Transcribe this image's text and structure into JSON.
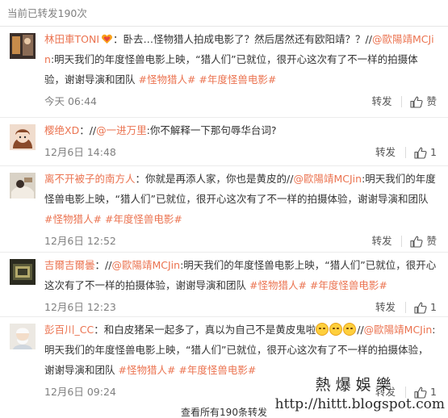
{
  "header": {
    "title": "当前已转发190次"
  },
  "reposts": [
    {
      "user": "林田車TONI",
      "segments": [
        "：卧去…怪物猎人拍成电影了？然后居然还有欧阳靖？？//",
        "@歐陽靖MCJin",
        ":明天我们的年度怪兽电影上映，“猎人们”已就位，很开心这次有了不一样的拍摄体验，谢谢导演和团队 ",
        "#怪物猎人#",
        " ",
        "#年度怪兽电影#"
      ],
      "time": "今天 06:44",
      "repost_label": "转发",
      "like_label": "赞"
    },
    {
      "user": "樱绝XD",
      "segments": [
        "：//",
        "@一进万里",
        ":你不解释一下那句辱华台词?"
      ],
      "time": "12月6日 14:48",
      "repost_label": "转发",
      "like_label": "1"
    },
    {
      "user": "离不开被子的南方人",
      "segments": [
        "：你就是再添人家，你也是黄皮的//",
        "@歐陽靖MCJin",
        ":明天我们的年度怪兽电影上映，“猎人们”已就位，很开心这次有了不一样的拍摄体验，谢谢导演和团队 ",
        "#怪物猎人#",
        " ",
        "#年度怪兽电影#"
      ],
      "time": "12月6日 12:52",
      "repost_label": "转发",
      "like_label": "赞"
    },
    {
      "user": "吉爾吉爾曇",
      "segments": [
        "：//",
        "@歐陽靖MCJin",
        ":明天我们的年度怪兽电影上映，“猎人们”已就位，很开心这次有了不一样的拍摄体验，谢谢导演和团队 ",
        "#怪物猎人#",
        " ",
        "#年度怪兽电影#"
      ],
      "time": "12月6日 12:23",
      "repost_label": "转发",
      "like_label": "1"
    },
    {
      "user": "彭百川_CC",
      "segments": [
        "：和白皮猪呆一起多了，真以为自己不是黄皮鬼啦",
        "EMOJI",
        "//",
        "@歐陽靖MCJin",
        ":明天我们的年度怪兽电影上映，“猎人们”已就位，很开心这次有了不一样的拍摄体验，谢谢导演和团队 ",
        "#怪物猎人#",
        " ",
        "#年度怪兽电影#"
      ],
      "time": "12月6日 09:24",
      "repost_label": "转发",
      "like_label": "1"
    }
  ],
  "watermark": {
    "line1": "熱爆娛樂",
    "line2": "http://hittt.blogspot.com"
  },
  "footer": {
    "text": "查看所有190条转发"
  },
  "colors": {
    "link": "#eb7350",
    "meta": "#808080"
  }
}
